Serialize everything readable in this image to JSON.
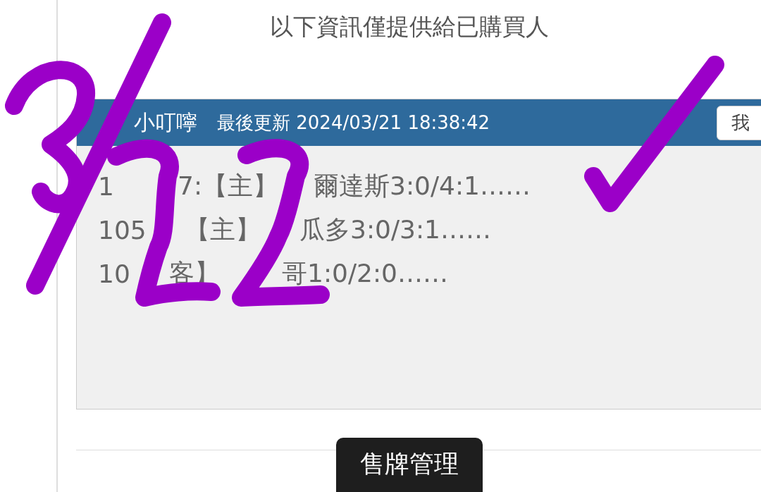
{
  "notice": "以下資訊僅提供給已購買人",
  "tip_panel": {
    "title": "小叮嚀",
    "updated_label": "最後更新",
    "updated_time": "2024/03/21 18:38:42",
    "button": "我",
    "lines": [
      {
        "parts": [
          "1",
          "7:【主】",
          "爾達斯3:0/4:1……"
        ]
      },
      {
        "parts": [
          "105",
          "【主】",
          "瓜多3:0/3:1……"
        ]
      },
      {
        "parts": [
          "10",
          "客】",
          "哥1:0/2:0……"
        ]
      }
    ]
  },
  "bottom_button": "售牌管理"
}
